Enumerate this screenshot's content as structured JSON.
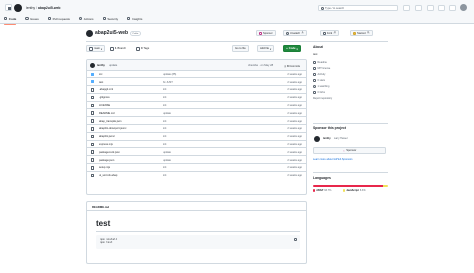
{
  "header": {
    "owner": "lenthy",
    "repo": "abap2ui5-web",
    "search_placeholder": "Type / to search",
    "tabs": [
      {
        "label": "Code",
        "icon": "code-icon",
        "active": true
      },
      {
        "label": "Issues",
        "icon": "issue-icon",
        "active": false
      },
      {
        "label": "Pull requests",
        "icon": "pull-request-icon",
        "active": false
      },
      {
        "label": "Actions",
        "icon": "play-icon",
        "active": false
      },
      {
        "label": "Security",
        "icon": "shield-icon",
        "active": false
      },
      {
        "label": "Insights",
        "icon": "graph-icon",
        "active": false
      }
    ]
  },
  "repo": {
    "name": "abap2ui5-web",
    "visibility": "Public",
    "sponsor_label": "Sponsor",
    "unwatch_label": "Unwatch",
    "unwatch_count": "1",
    "fork_label": "Fork",
    "fork_count": "0",
    "starred_label": "Starred",
    "starred_count": "0"
  },
  "toolbar": {
    "branch": "main",
    "branch_count": "1",
    "branch_label": "Branch",
    "tags_count": "0",
    "tags_label": "Tags",
    "goto_label": "Go to file",
    "add_label": "Add file",
    "code_label": "Code"
  },
  "commit": {
    "author": "lenthy",
    "message": "update",
    "sha_time": "cba1cbe · on May 28",
    "commits_count": "8",
    "commits_label": "Commits"
  },
  "files": [
    {
      "name": "src",
      "type": "dir",
      "message": "update (#5)",
      "time": "2 weeks ago"
    },
    {
      "name": "test",
      "type": "dir",
      "message": "fix JUST",
      "time": "2 weeks ago"
    },
    {
      "name": ".abapgit.xml",
      "type": "file",
      "message": "init",
      "time": "2 weeks ago"
    },
    {
      "name": ".gitignore",
      "type": "file",
      "message": "init",
      "time": "2 weeks ago"
    },
    {
      "name": "LICENSE",
      "type": "file",
      "message": "init",
      "time": "2 weeks ago"
    },
    {
      "name": "README.md",
      "type": "file",
      "message": "update",
      "time": "2 weeks ago"
    },
    {
      "name": "abap_transpile.json",
      "type": "file",
      "message": "init",
      "time": "2 weeks ago"
    },
    {
      "name": "abaplint-downport.jsonc",
      "type": "file",
      "message": "init",
      "time": "2 weeks ago"
    },
    {
      "name": "abaplint.jsonc",
      "type": "file",
      "message": "init",
      "time": "2 weeks ago"
    },
    {
      "name": "express.mjs",
      "type": "file",
      "message": "init",
      "time": "2 weeks ago"
    },
    {
      "name": "package-lock.json",
      "type": "file",
      "message": "update",
      "time": "2 weeks ago"
    },
    {
      "name": "package.json",
      "type": "file",
      "message": "update",
      "time": "2 weeks ago"
    },
    {
      "name": "setup.mjs",
      "type": "file",
      "message": "init",
      "time": "2 weeks ago"
    },
    {
      "name": "ui_sort.idx.abap",
      "type": "file",
      "message": "init",
      "time": "2 weeks ago"
    }
  ],
  "readme": {
    "tab_label": "README.md",
    "title": "test",
    "code_lines": [
      "npm install",
      "npm test"
    ]
  },
  "sidebar": {
    "about_title": "About",
    "description": "test",
    "items": [
      {
        "icon": "book-icon",
        "label": "Readme"
      },
      {
        "icon": "law-icon",
        "label": "MIT license"
      },
      {
        "icon": "pulse-icon",
        "label": "Activity"
      },
      {
        "icon": "star-icon",
        "label": "0 stars"
      },
      {
        "icon": "eye-icon",
        "label": "1 watching"
      },
      {
        "icon": "fork-icon",
        "label": "0 forks"
      }
    ],
    "report_label": "Report repository",
    "sponsor_title": "Sponsor this project",
    "sponsor_user": "lenthy",
    "sponsor_sub": "Larry Hussel",
    "sponsor_button": "Sponsor",
    "sponsor_link": "Learn more about GitHub Sponsors",
    "languages_title": "Languages",
    "languages": [
      {
        "name": "ABAP",
        "percent": "93.7%",
        "color": "#e8274b",
        "value": 93.7
      },
      {
        "name": "JavaScript",
        "percent": "6.3%",
        "color": "#f1e05a",
        "value": 6.3
      }
    ]
  }
}
